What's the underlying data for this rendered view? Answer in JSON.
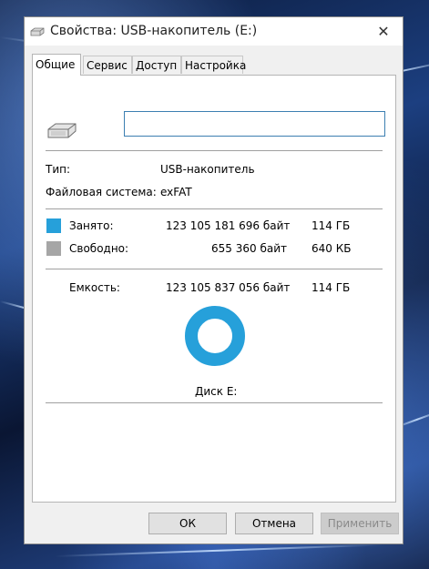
{
  "window": {
    "title": "Свойства: USB-накопитель (E:)",
    "close_icon": "close-icon"
  },
  "tabs": [
    {
      "label": "Общие",
      "active": true
    },
    {
      "label": "Сервис",
      "active": false
    },
    {
      "label": "Доступ",
      "active": false
    },
    {
      "label": "Настройка",
      "active": false
    }
  ],
  "general": {
    "volume_label_value": "",
    "type_label": "Тип:",
    "type_value": "USB-накопитель",
    "fs_label": "Файловая система:",
    "fs_value": "exFAT",
    "used_label": "Занято:",
    "used_bytes": "123 105 181 696 байт",
    "used_size": "114 ГБ",
    "used_color": "#26a0da",
    "free_label": "Свободно:",
    "free_bytes": "655 360 байт",
    "free_size": "640 КБ",
    "free_color": "#a6a6a6",
    "capacity_label": "Емкость:",
    "capacity_bytes": "123 105 837 056 байт",
    "capacity_size": "114 ГБ",
    "disk_label": "Диск E:"
  },
  "buttons": {
    "ok": "ОК",
    "cancel": "Отмена",
    "apply": "Применить"
  }
}
